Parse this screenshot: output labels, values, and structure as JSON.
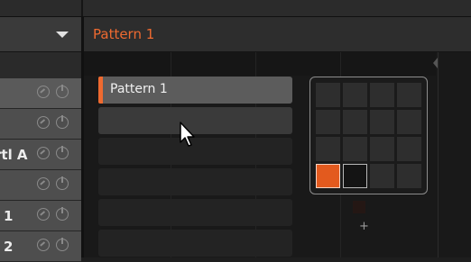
{
  "editor": {
    "title": "Pattern 1"
  },
  "group_list": {
    "rows": [
      {
        "label": ""
      },
      {
        "label": ""
      },
      {
        "label": "rtl A"
      },
      {
        "label": ""
      },
      {
        "label": "1"
      },
      {
        "label": "2"
      }
    ]
  },
  "patterns": [
    {
      "name": "Pattern 1",
      "selected": true
    },
    {
      "name": ""
    }
  ],
  "bank_grid": {
    "selected_bank": 13
  },
  "buttons": {
    "add_bank": "+"
  },
  "colors": {
    "accent": "#ee6a30",
    "selected_bank": "#e35a1e"
  },
  "icons": {
    "dropdown": "chevron-down-icon",
    "cursor": "mouse-pointer-icon",
    "knob": "knob-icon"
  }
}
